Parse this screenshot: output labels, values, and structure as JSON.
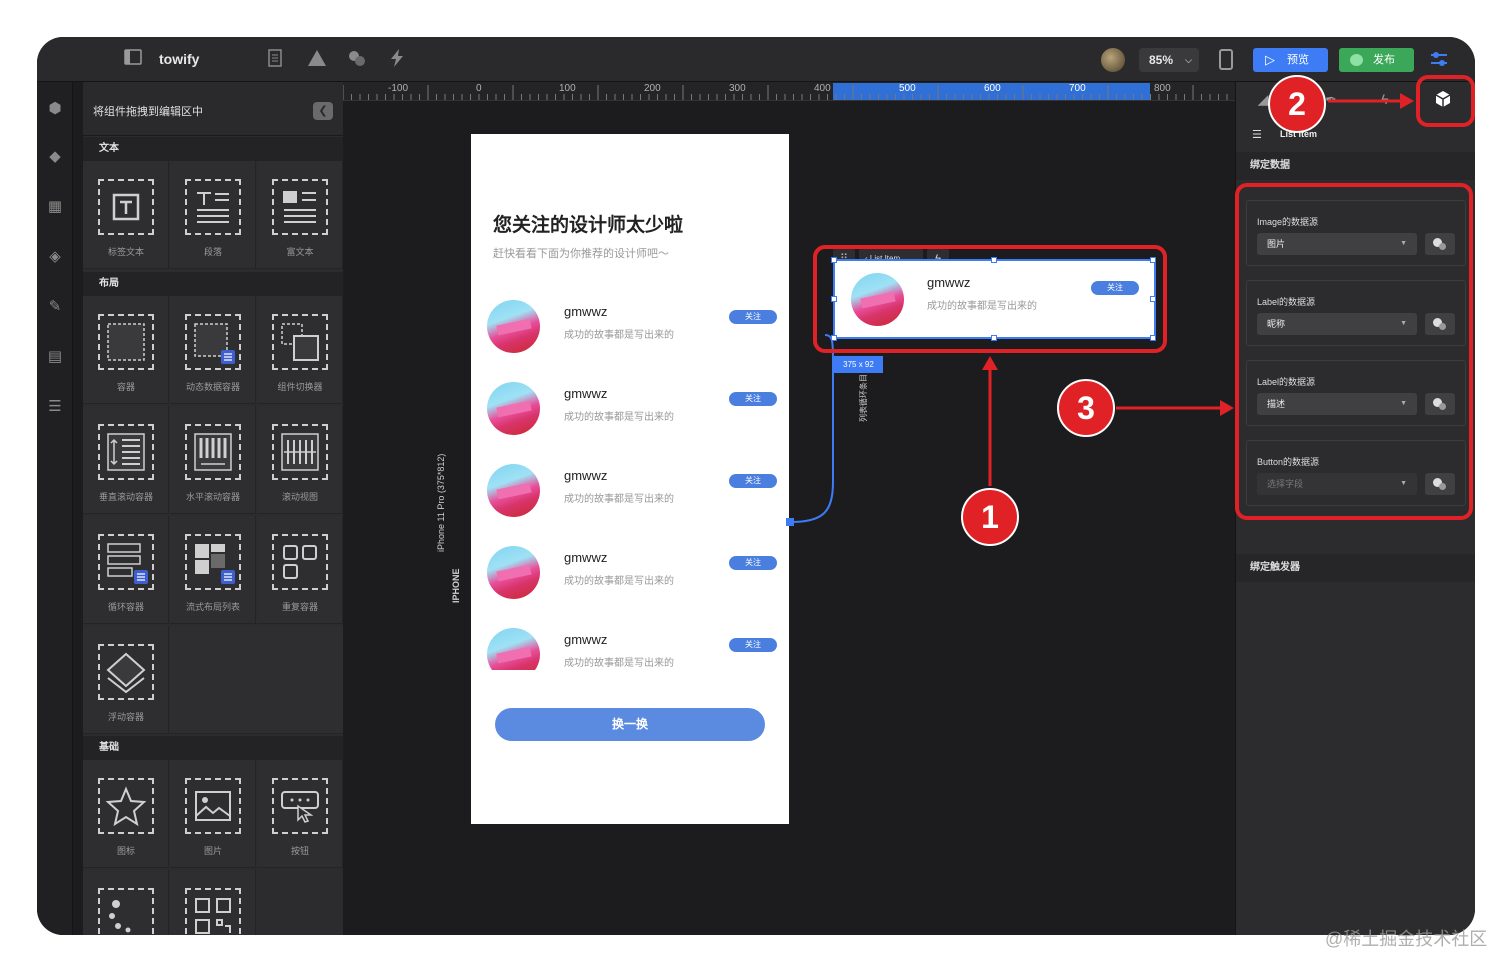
{
  "app": {
    "title": "towify"
  },
  "topbar": {
    "zoom": "85%",
    "preview_label": "预览",
    "publish_label": "发布",
    "colors": {
      "preview": "#3d7cf5",
      "publish": "#3aa858"
    }
  },
  "left_panel": {
    "title": "将组件拖拽到编辑区中",
    "sections": [
      {
        "label": "文本",
        "items": [
          "标签文本",
          "段落",
          "富文本"
        ]
      },
      {
        "label": "布局",
        "items": [
          "容器",
          "动态数据容器",
          "组件切换器",
          "垂直滚动容器",
          "水平滚动容器",
          "滚动视图",
          "循环容器",
          "流式布局列表",
          "重复容器",
          "浮动容器"
        ]
      },
      {
        "label": "基础",
        "items": [
          "图标",
          "图片",
          "按钮"
        ]
      }
    ]
  },
  "ruler": {
    "marks": [
      "-100",
      "0",
      "100",
      "200",
      "300",
      "400",
      "500",
      "600",
      "700",
      "800"
    ]
  },
  "phone": {
    "device_label": "iPhone 11 Pro (375*812)",
    "device_type": "IPHONE",
    "title": "您关注的设计师太少啦",
    "subtitle": "赶快看看下面为你推荐的设计师吧～",
    "list": [
      {
        "name": "gmwwz",
        "desc": "成功的故事都是写出来的",
        "button": "关注"
      },
      {
        "name": "gmwwz",
        "desc": "成功的故事都是写出来的",
        "button": "关注"
      },
      {
        "name": "gmwwz",
        "desc": "成功的故事都是写出来的",
        "button": "关注"
      },
      {
        "name": "gmwwz",
        "desc": "成功的故事都是写出来的",
        "button": "关注"
      },
      {
        "name": "gmwwz",
        "desc": "成功的故事都是写出来的",
        "button": "关注"
      }
    ],
    "swap_button": "换一换"
  },
  "selection": {
    "toolbar_label": "List Item",
    "item": {
      "name": "gmwwz",
      "desc": "成功的故事都是写出来的",
      "button": "关注"
    },
    "size": "375 x 92",
    "loop_label": "列表循环条目"
  },
  "right_panel": {
    "breadcrumb": "List Item",
    "bind_data_label": "绑定数据",
    "bind_trigger_label": "绑定触发器",
    "bindings": [
      {
        "label": "Image的数据源",
        "value": "图片",
        "empty": false
      },
      {
        "label": "Label的数据源",
        "value": "昵称",
        "empty": false
      },
      {
        "label": "Label的数据源",
        "value": "描述",
        "empty": false
      },
      {
        "label": "Button的数据源",
        "value": "选择字段",
        "empty": true
      }
    ]
  },
  "annotations": {
    "badges": [
      "1",
      "2",
      "3"
    ],
    "color": "#e02226"
  },
  "watermark": "@稀土掘金技术社区"
}
